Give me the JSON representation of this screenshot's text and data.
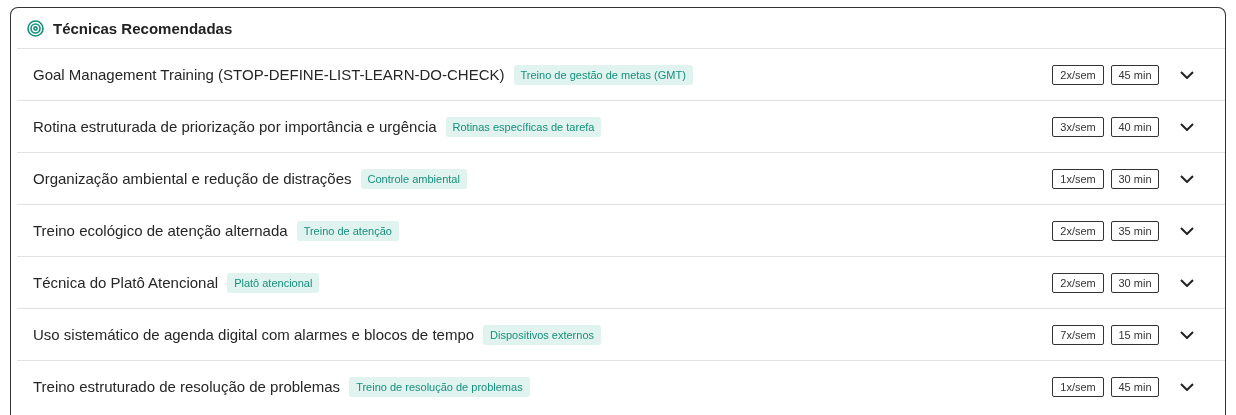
{
  "panel": {
    "title": "Técnicas Recomendadas"
  },
  "techniques": [
    {
      "name": "Goal Management Training (STOP-DEFINE-LIST-LEARN-DO-CHECK)",
      "tag": "Treino de gestão de metas (GMT)",
      "frequency": "2x/sem",
      "duration": "45 min",
      "expanded": false
    },
    {
      "name": "Rotina estruturada de priorização por importância e urgência",
      "tag": "Rotinas específicas de tarefa",
      "frequency": "3x/sem",
      "duration": "40 min",
      "expanded": false
    },
    {
      "name": "Organização ambiental e redução de distrações",
      "tag": "Controle ambiental",
      "frequency": "1x/sem",
      "duration": "30 min",
      "expanded": false
    },
    {
      "name": "Treino ecológico de atenção alternada",
      "tag": "Treino de atenção",
      "frequency": "2x/sem",
      "duration": "35 min",
      "expanded": false
    },
    {
      "name": "Técnica do Platô Atencional",
      "tag": "Platô atencional",
      "frequency": "2x/sem",
      "duration": "30 min",
      "expanded": false
    },
    {
      "name": "Uso sistemático de agenda digital com alarmes e blocos de tempo",
      "tag": "Dispositivos externos",
      "frequency": "7x/sem",
      "duration": "15 min",
      "expanded": false
    },
    {
      "name": "Treino estruturado de resolução de problemas",
      "tag": "Treino de resolução de problemas",
      "frequency": "1x/sem",
      "duration": "45 min",
      "expanded": false
    }
  ]
}
